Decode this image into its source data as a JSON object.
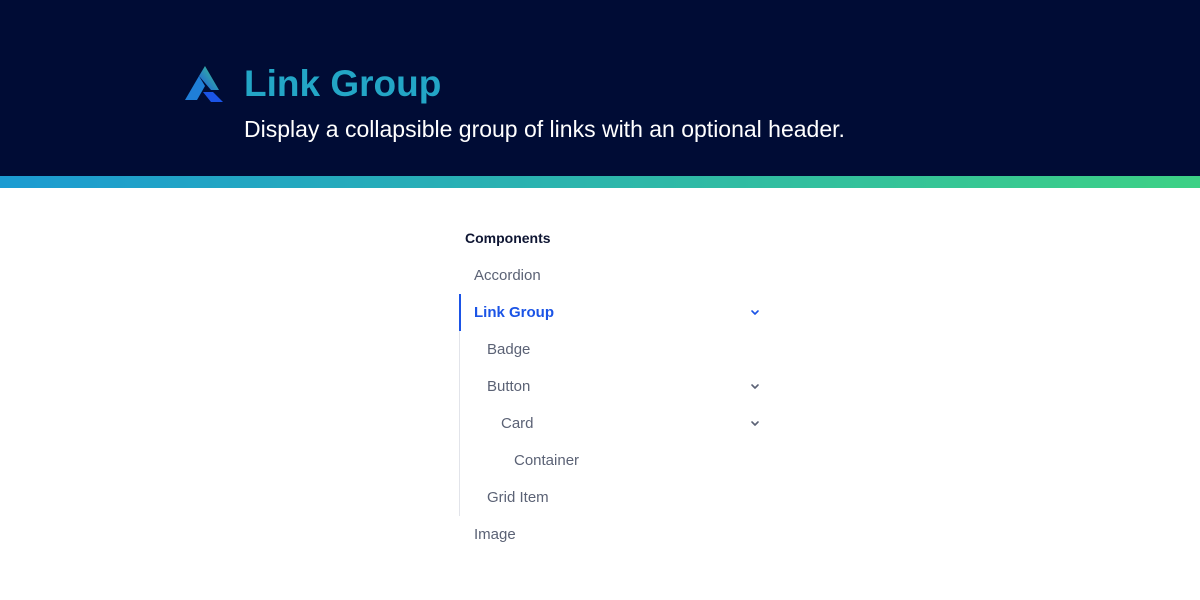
{
  "header": {
    "title": "Link Group",
    "subtitle": "Display a collapsible group of links with an optional header.",
    "logo_icon": "brand-logo-icon"
  },
  "colors": {
    "banner_bg": "#000c35",
    "title": "#23a6c6",
    "gradient_start": "#1c9bd2",
    "gradient_end": "#3dd185",
    "active": "#1b54e6",
    "item_text": "#5b6275"
  },
  "nav": {
    "section_title": "Components",
    "items": {
      "accordion": {
        "label": "Accordion"
      },
      "link_group": {
        "label": "Link Group",
        "expanded": true,
        "active": true
      },
      "badge": {
        "label": "Badge"
      },
      "button": {
        "label": "Button",
        "expanded": true
      },
      "card": {
        "label": "Card",
        "expanded": true
      },
      "container": {
        "label": "Container"
      },
      "grid_item": {
        "label": "Grid Item"
      },
      "image": {
        "label": "Image"
      }
    },
    "chevron_icon": "chevron-down-icon"
  }
}
